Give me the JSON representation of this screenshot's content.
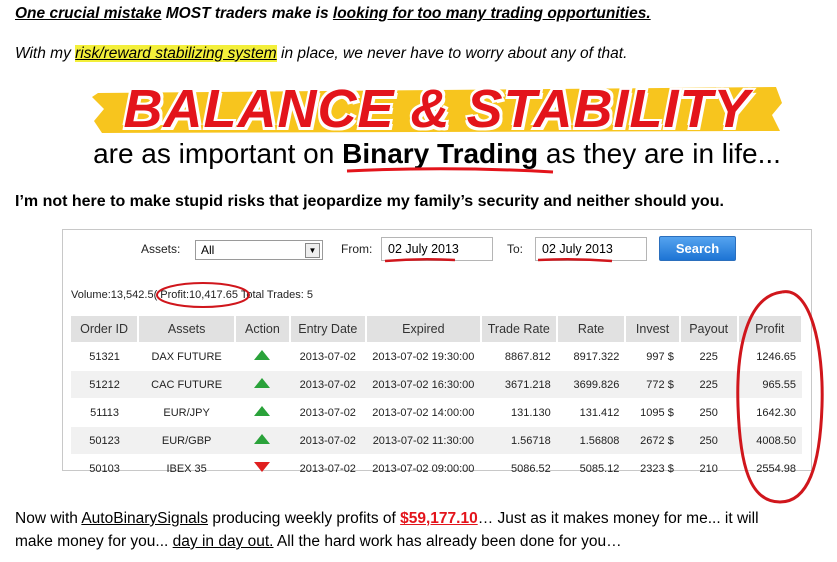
{
  "intro": {
    "line1_part1": "One crucial mistake",
    "line1_part2": " MOST traders make is ",
    "line1_part3": "looking for too many trading opportunities.",
    "line2_part1": "With my ",
    "line2_highlight": "risk/reward stabilizing system",
    "line2_part2": " in place, we never have to worry about any of that."
  },
  "banner": {
    "title": "BALANCE & STABILITY",
    "sub_part1": "are as important on ",
    "sub_bold": "Binary Trading",
    "sub_part2": " as they are in life...",
    "colors": {
      "title": "#e3141b",
      "stripe": "#f7c51e",
      "underline": "#e3141b"
    }
  },
  "statement": "I’m not here to make stupid risks that jeopardize my family’s security and neither should you.",
  "trading_panel": {
    "filters": {
      "assets_label": "Assets:",
      "assets_value": "All",
      "from_label": "From:",
      "from_value": "02 July 2013",
      "to_label": "To:",
      "to_value": "02 July  2013",
      "search_button": "Search"
    },
    "summary": {
      "volume": "Volume:13,542.5(",
      "profit": "Profit:10,417.65",
      "trades": "Total Trades: 5"
    },
    "columns": [
      "Order ID",
      "Assets",
      "Action",
      "Entry Date",
      "Expired",
      "Trade Rate",
      "Rate",
      "Invest",
      "Payout",
      "Profit"
    ],
    "rows": [
      {
        "order_id": "51321",
        "asset": "DAX FUTURE",
        "action": "up",
        "entry": "2013-07-02",
        "expired": "2013-07-02 19:30:00",
        "trade_rate": "8867.812",
        "rate": "8917.322",
        "invest": "997 $",
        "payout": "225",
        "profit": "1246.65"
      },
      {
        "order_id": "51212",
        "asset": "CAC FUTURE",
        "action": "up",
        "entry": "2013-07-02",
        "expired": "2013-07-02 16:30:00",
        "trade_rate": "3671.218",
        "rate": "3699.826",
        "invest": "772 $",
        "payout": "225",
        "profit": "965.55"
      },
      {
        "order_id": "51113",
        "asset": "EUR/JPY",
        "action": "up",
        "entry": "2013-07-02",
        "expired": "2013-07-02 14:00:00",
        "trade_rate": "131.130",
        "rate": "131.412",
        "invest": "1095 $",
        "payout": "250",
        "profit": "1642.30"
      },
      {
        "order_id": "50123",
        "asset": "EUR/GBP",
        "action": "up",
        "entry": "2013-07-02",
        "expired": "2013-07-02 11:30:00",
        "trade_rate": "1.56718",
        "rate": "1.56808",
        "invest": "2672 $",
        "payout": "250",
        "profit": "4008.50"
      },
      {
        "order_id": "50103",
        "asset": "IBEX 35",
        "action": "down",
        "entry": "2013-07-02",
        "expired": "2013-07-02 09:00:00",
        "trade_rate": "5086.52",
        "rate": "5085.12",
        "invest": "2323 $",
        "payout": "210",
        "profit": "2554.98"
      }
    ]
  },
  "closing": {
    "part1": "Now with ",
    "link": "AutoBinarySignals",
    "part2": " producing weekly profits of ",
    "amount": "$59,177.10",
    "part3": "… Just as it makes money for me... it will",
    "line2_part1": "make money for you... ",
    "line2_link": "day in day out.",
    "line2_part2": " All the hard work has already been done for you…"
  }
}
